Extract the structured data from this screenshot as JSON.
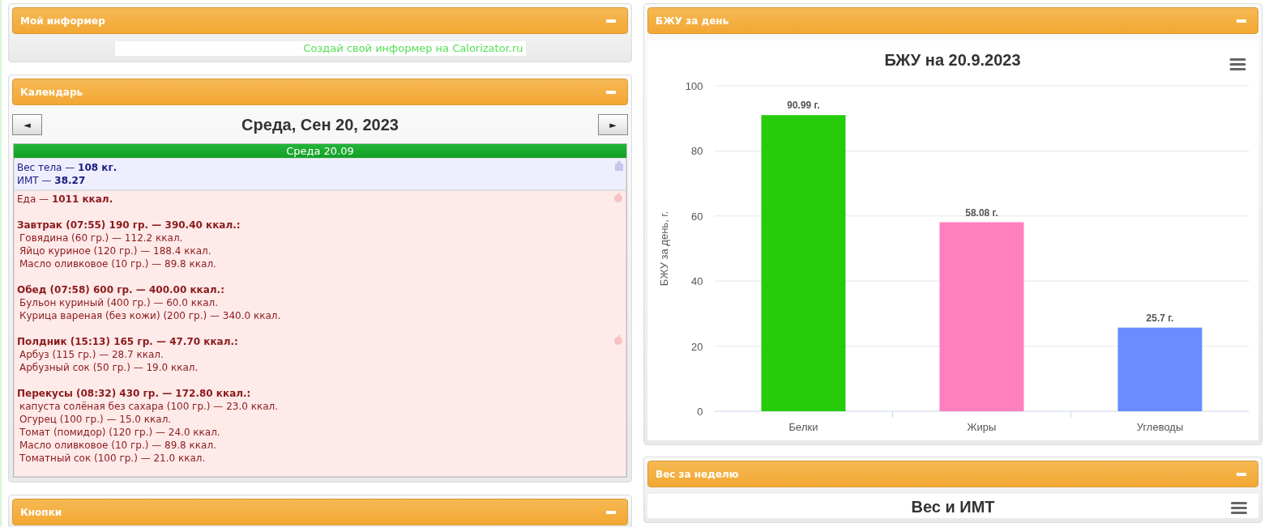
{
  "informer": {
    "title": "Мой информер",
    "link": "Создай свой информер на Calorizator.ru"
  },
  "calendar": {
    "title": "Календарь",
    "prev": "◄",
    "next": "►",
    "date": "Среда, Сен 20, 2023",
    "day_bar": "Среда 20.09",
    "body": [
      "Вес тела — **108 кг.**",
      "ИМТ — **38.27**"
    ],
    "food_total": "Еда — **1011 ккал.**",
    "meals": [
      {
        "heading": "Завтрак (07:55) 190 гр. — 390.40 ккал.:",
        "items": [
          "Говядина (60 гр.) — 112.2 ккал.",
          "Яйцо куриное (120 гр.) — 188.4 ккал.",
          "Масло оливковое (10 гр.) — 89.8 ккал."
        ]
      },
      {
        "heading": "Обед (07:58) 600 гр. — 400.00 ккал.:",
        "items": [
          "Бульон куриный (400 гр.) — 60.0 ккал.",
          "Курица вареная (без кожи) (200 гр.) — 340.0 ккал."
        ]
      },
      {
        "heading": "Полдник (15:13) 165 гр. — 47.70 ккал.:",
        "items": [
          "Арбуз (115 гр.) — 28.7 ккал.",
          "Арбузный сок (50 гр.) — 19.0 ккал."
        ]
      },
      {
        "heading": "Перекусы (08:32) 430 гр. — 172.80 ккал.:",
        "items": [
          "капуста солёная без сахара (100 гр.) — 23.0 ккал.",
          "Огурец (100 гр.) — 15.0 ккал.",
          "Томат (помидор) (120 гр.) — 24.0 ккал.",
          "Масло оливковое (10 гр.) — 89.8 ккал.",
          "Томатный сок (100 гр.) — 21.0 ккал."
        ]
      }
    ]
  },
  "buttons_panel": {
    "title": "Кнопки"
  },
  "bju_panel": {
    "title": "БЖУ за день",
    "chart_data": {
      "type": "bar",
      "title": "БЖУ на 20.9.2023",
      "ylabel": "БЖУ за день, г.",
      "categories": [
        "Белки",
        "Жиры",
        "Углеводы"
      ],
      "values": [
        90.99,
        58.08,
        25.7
      ],
      "colors": [
        "#26cc0a",
        "#ff7fbf",
        "#6b8cff"
      ],
      "grid": true,
      "ylim": [
        0,
        100
      ],
      "yticks": [
        0,
        20,
        40,
        60,
        80,
        100
      ],
      "value_labels": [
        "90.99 г.",
        "58.08 г.",
        "25.7 г."
      ]
    }
  },
  "weight_panel": {
    "title": "Вес за неделю",
    "chart_title": "Вес и ИМТ"
  }
}
